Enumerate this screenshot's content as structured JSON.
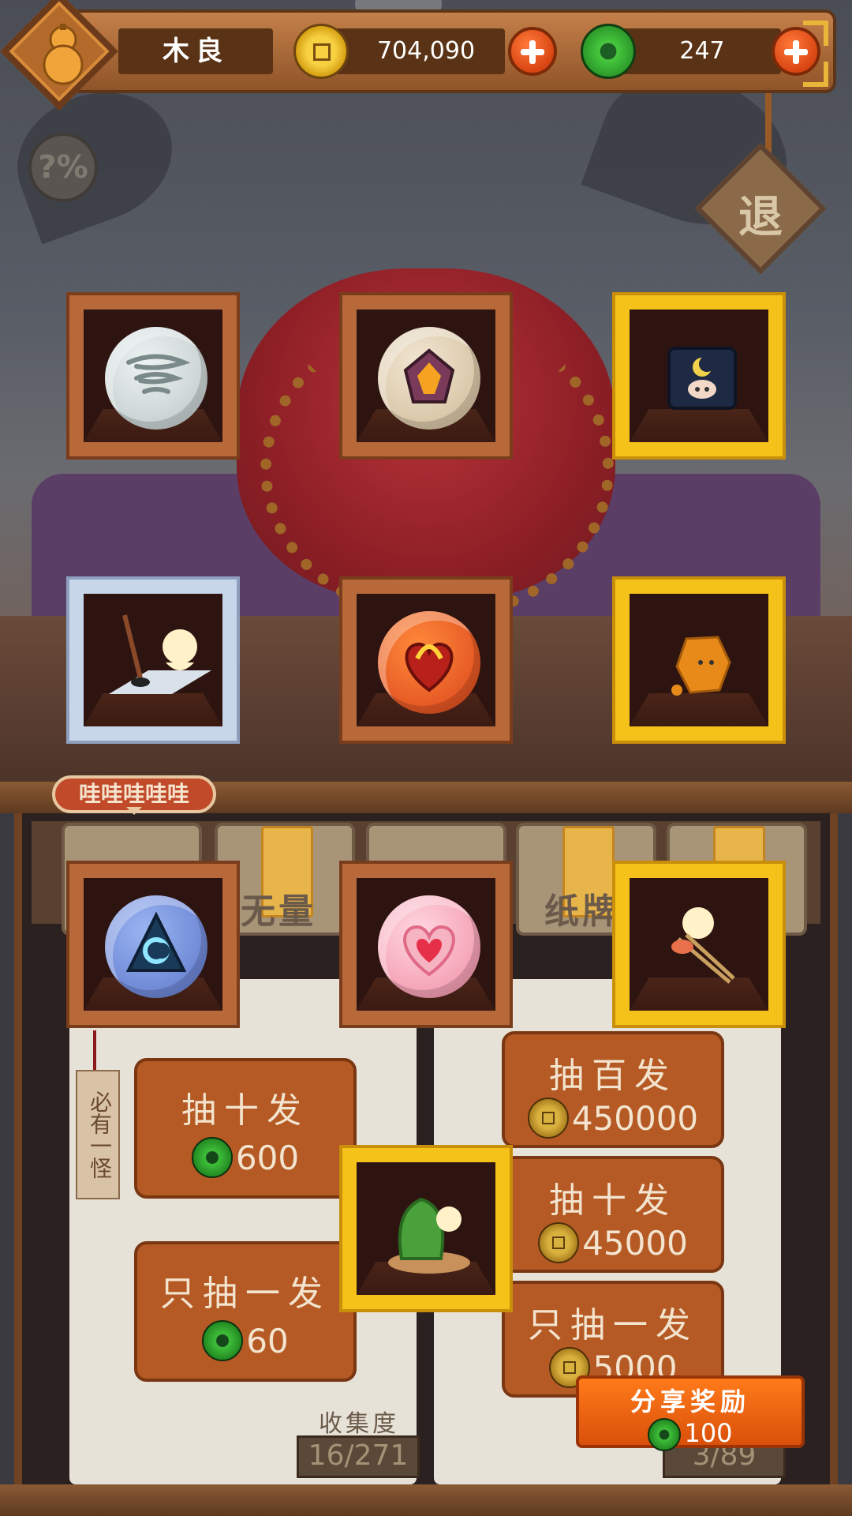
{
  "player": {
    "name": "木良",
    "gold": "704,090",
    "jade": "247"
  },
  "icons": {
    "avatar": "gourd-icon",
    "gold_currency": "copper-coin-icon",
    "jade_currency": "jade-coin-icon",
    "add": "plus-icon",
    "probability": "percent-icon",
    "exit": "exit-sign-icon"
  },
  "misc": {
    "probability_label": "?%",
    "exit_label": "退",
    "speech_bubble": "哇哇哇哇哇",
    "tag_label": "必有一怪"
  },
  "rewards": [
    {
      "rarity": "copper",
      "item": "tornado-orb"
    },
    {
      "rarity": "copper",
      "item": "fire-gem-orb"
    },
    {
      "rarity": "gold",
      "item": "moon-scroll"
    },
    {
      "rarity": "silver",
      "item": "ink-brush-spirit"
    },
    {
      "rarity": "copper",
      "item": "flame-heart-orb"
    },
    {
      "rarity": "gold",
      "item": "rock-sprite"
    },
    {
      "rarity": "copper",
      "item": "moon-rune-orb"
    },
    {
      "rarity": "copper",
      "item": "pink-heart-orb"
    },
    {
      "rarity": "gold",
      "item": "chopstick-spirit"
    },
    {
      "rarity": "gold",
      "item": "zongzi-spirit"
    }
  ],
  "shelf": {
    "label_1": "无量",
    "label_2": "纸牌"
  },
  "jade_shop": {
    "draw_ten": {
      "label": "抽十发",
      "price": "600"
    },
    "draw_one": {
      "label": "只抽一发",
      "price": "60"
    }
  },
  "gold_shop": {
    "draw_hundred": {
      "label": "抽百发",
      "price": "450000"
    },
    "draw_ten": {
      "label": "抽十发",
      "price": "45000"
    },
    "draw_one": {
      "label": "只抽一发",
      "price": "5000"
    }
  },
  "collection": {
    "label": "收集度",
    "left_count": "16/271",
    "right_count": "3/89"
  },
  "share": {
    "label": "分享奖励",
    "reward": "100"
  },
  "colors": {
    "copper_frame": "#b8693a",
    "gold_frame": "#f5c21a",
    "silver_frame": "#c8d6ea",
    "button_orange": "#b55a24",
    "share_orange": "#ff7a1a"
  }
}
